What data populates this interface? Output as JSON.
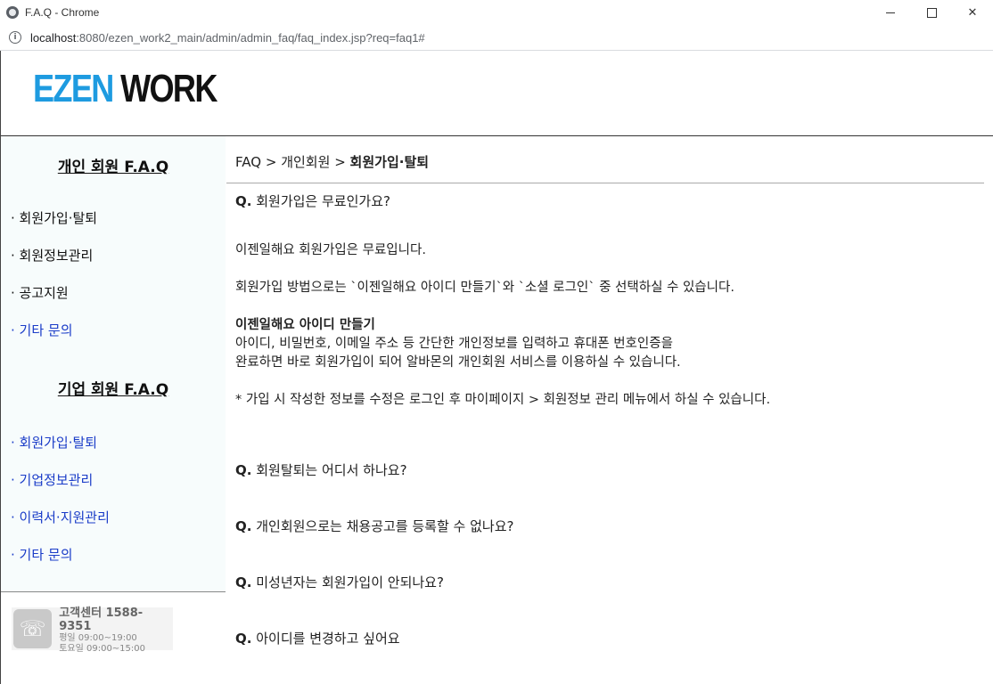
{
  "window": {
    "title": "F.A.Q - Chrome",
    "url_host": "localhost",
    "url_path": ":8080/ezen_work2_main/admin/admin_faq/faq_index.jsp?req=faq1#"
  },
  "logo": {
    "part1": "EZEN",
    "part2": "WORK"
  },
  "sidebar": {
    "personal_heading": "개인 회원 F.A.Q",
    "personal_items": [
      "· 회원가입·탈퇴",
      "· 회원정보관리",
      "· 공고지원",
      "· 기타 문의"
    ],
    "company_heading": "기업 회원 F.A.Q",
    "company_items": [
      "· 회원가입·탈퇴",
      "· 기업정보관리",
      "· 이력서·지원관리",
      "· 기타 문의"
    ],
    "support": {
      "title": "고객센터 1588-9351",
      "weekday": "평일 09:00~19:00",
      "saturday": "토요일 09:00~15:00"
    }
  },
  "breadcrumb": {
    "root": "FAQ",
    "sep": ">",
    "level1": "개인회원",
    "current": "회원가입·탈퇴"
  },
  "faq": {
    "q_mark": "Q.",
    "q1": "회원가입은 무료인가요?",
    "a1_line1": "이젠일해요 회원가입은 무료입니다.",
    "a1_line2": "회원가입 방법으로는 `이젠일해요 아이디 만들기`와 `소셜 로그인` 중 선택하실 수 있습니다.",
    "a1_bold": "이젠일해요 아이디 만들기",
    "a1_line3": "아이디, 비밀번호, 이메일 주소 등 간단한 개인정보를 입력하고 휴대폰 번호인증을",
    "a1_line4": "완료하면 바로 회원가입이 되어 알바몬의 개인회원 서비스를 이용하실 수 있습니다.",
    "a1_note": "* 가입 시 작성한 정보를 수정은 로그인 후 마이페이지 > 회원정보 관리 메뉴에서 하실 수 있습니다.",
    "q2": "회원탈퇴는 어디서 하나요?",
    "q3": "개인회원으로는 채용공고를 등록할 수 없나요?",
    "q4": "미성년자는 회원가입이 안되나요?",
    "q5": "아이디를 변경하고 싶어요"
  }
}
